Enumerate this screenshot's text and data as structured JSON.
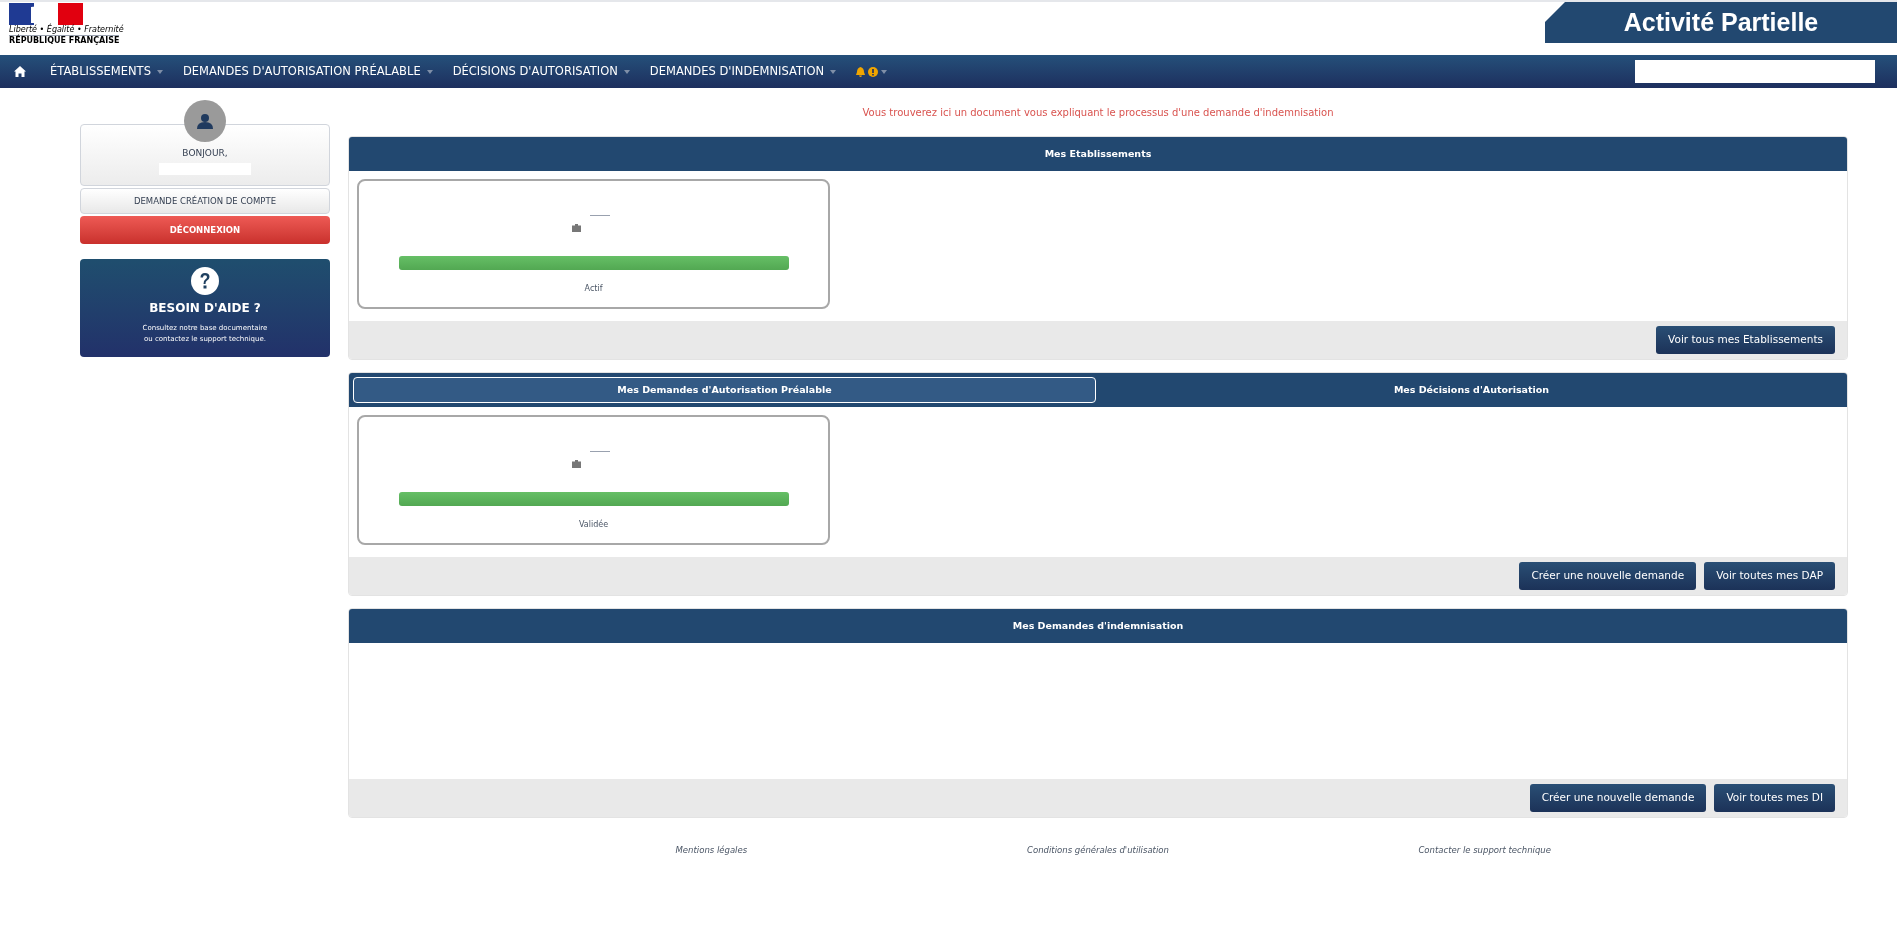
{
  "header": {
    "motto": "Liberté • Égalité • Fraternité",
    "republic": "RÉPUBLIQUE FRANÇAISE",
    "title": "Activité Partielle"
  },
  "nav": [
    {
      "kind": "home"
    },
    {
      "kind": "menu",
      "label": "ÉTABLISSEMENTS"
    },
    {
      "kind": "menu",
      "label": "DEMANDES D'AUTORISATION PRÉALABLE"
    },
    {
      "kind": "menu",
      "label": "DÉCISIONS D'AUTORISATION"
    },
    {
      "kind": "menu",
      "label": "DEMANDES D'INDEMNISATION"
    },
    {
      "kind": "alerts"
    }
  ],
  "sidebar": {
    "greeting": "BONJOUR,",
    "buttons": [
      {
        "label": "DEMANDE CRÉATION DE COMPTE",
        "kind": "default"
      },
      {
        "label": "DÉCONNEXION",
        "kind": "danger"
      }
    ],
    "help": {
      "title": "BESOIN D'AIDE ?",
      "text": "Consultez notre base documentaire\nou contactez le support technique."
    }
  },
  "notice": "Vous trouverez ici un document vous expliquant le processus d'une demande d'indemnisation",
  "panels": [
    {
      "tabs": [
        {
          "label": "Mes Etablissements",
          "selected": false
        }
      ],
      "cards": [
        {
          "status": "Actif",
          "level": 1
        }
      ],
      "buttons": [
        "Voir tous mes Etablissements"
      ]
    },
    {
      "tabs": [
        {
          "label": "Mes Demandes d'Autorisation Préalable",
          "selected": true
        },
        {
          "label": "Mes Décisions d'Autorisation",
          "selected": false
        }
      ],
      "cards": [
        {
          "status": "Validée",
          "level": 1
        }
      ],
      "buttons": [
        "Créer une nouvelle demande",
        "Voir toutes mes DAP"
      ]
    },
    {
      "tabs": [
        {
          "label": "Mes Demandes d'indemnisation",
          "selected": false
        }
      ],
      "buttons": [
        "Créer une nouvelle demande",
        "Voir toutes mes DI"
      ]
    }
  ],
  "footer": [
    "Mentions légales",
    "Conditions générales d'utilisation",
    "Contacter le support technique"
  ]
}
